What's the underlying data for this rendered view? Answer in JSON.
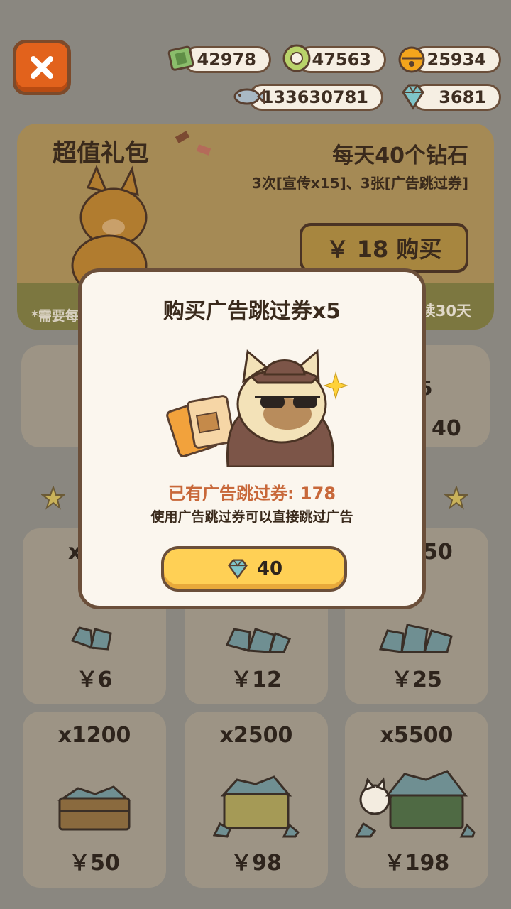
{
  "currencies": {
    "cash": "42978",
    "coins": "47563",
    "bells": "25934",
    "fish": "133630781",
    "diamonds": "3681"
  },
  "banner": {
    "title": "超值礼包",
    "subtitle": "每天40个钻石",
    "description": "3次[宣传x15]、3张[广告跳过券]",
    "buy_label": "￥ 18 购买",
    "footer_left": "*需要每",
    "footer_right": "续30天"
  },
  "row2": {
    "right_price_fragment": "40",
    "right_top_fragment": "5"
  },
  "shop": [
    {
      "qty": "x",
      "price": "￥6"
    },
    {
      "qty": "",
      "price": "￥12"
    },
    {
      "qty": "50",
      "price": "￥25"
    },
    {
      "qty": "x1200",
      "price": "￥50"
    },
    {
      "qty": "x2500",
      "price": "￥98"
    },
    {
      "qty": "x5500",
      "price": "￥198"
    }
  ],
  "modal": {
    "title": "购买广告跳过券x5",
    "owned": "已有广告跳过券: 178",
    "hint": "使用广告跳过券可以直接跳过广告",
    "cost": "40"
  },
  "colors": {
    "accent_orange": "#e2621c",
    "button_yellow": "#ffd055",
    "owned_text": "#c8683a",
    "diamond": "#7fc4c9"
  }
}
